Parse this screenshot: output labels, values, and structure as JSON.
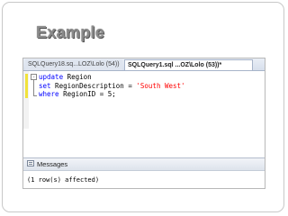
{
  "slide": {
    "title": "Example"
  },
  "editor": {
    "tabs": [
      {
        "label": "SQLQuery18.sq...LOZ\\Lolo (54))",
        "active": false
      },
      {
        "label": "SQLQuery1.sql ...OZ\\Lolo (53))*",
        "active": true
      }
    ],
    "outline_glyph": "-",
    "code": {
      "line1": {
        "kw": "update",
        "text": " Region"
      },
      "line2": {
        "kw": "set",
        "text": " RegionDescription = ",
        "string": "'South West'"
      },
      "line3": {
        "kw": "where",
        "text": " RegionID = 5;"
      }
    }
  },
  "messages": {
    "tab_label": "Messages",
    "result_text": "(1 row(s) affected)"
  }
}
